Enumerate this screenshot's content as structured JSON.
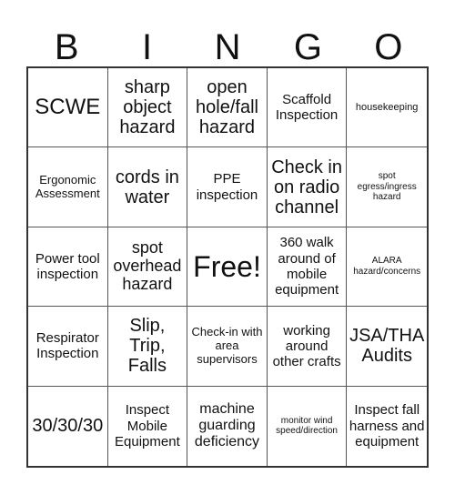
{
  "header": {
    "letters": [
      "B",
      "I",
      "N",
      "G",
      "O"
    ]
  },
  "cells": [
    "SCWE",
    "sharp object hazard",
    "open hole/fall hazard",
    "Scaffold Inspection",
    "housekeeping",
    "Ergonomic Assessment",
    "cords in water",
    "PPE inspection",
    "Check in on radio channel",
    "spot egress/ingress hazard",
    "Power tool inspection",
    "spot overhead hazard",
    "Free!",
    "360 walk around of mobile equipment",
    "ALARA hazard/concerns",
    "Respirator Inspection",
    "Slip, Trip, Falls",
    "Check-in with area supervisors",
    "working around other crafts",
    "JSA/THA Audits",
    "30/30/30",
    "Inspect Mobile Equipment",
    "machine guarding deficiency",
    "monitor wind speed/direction",
    "Inspect fall harness and equipment"
  ]
}
